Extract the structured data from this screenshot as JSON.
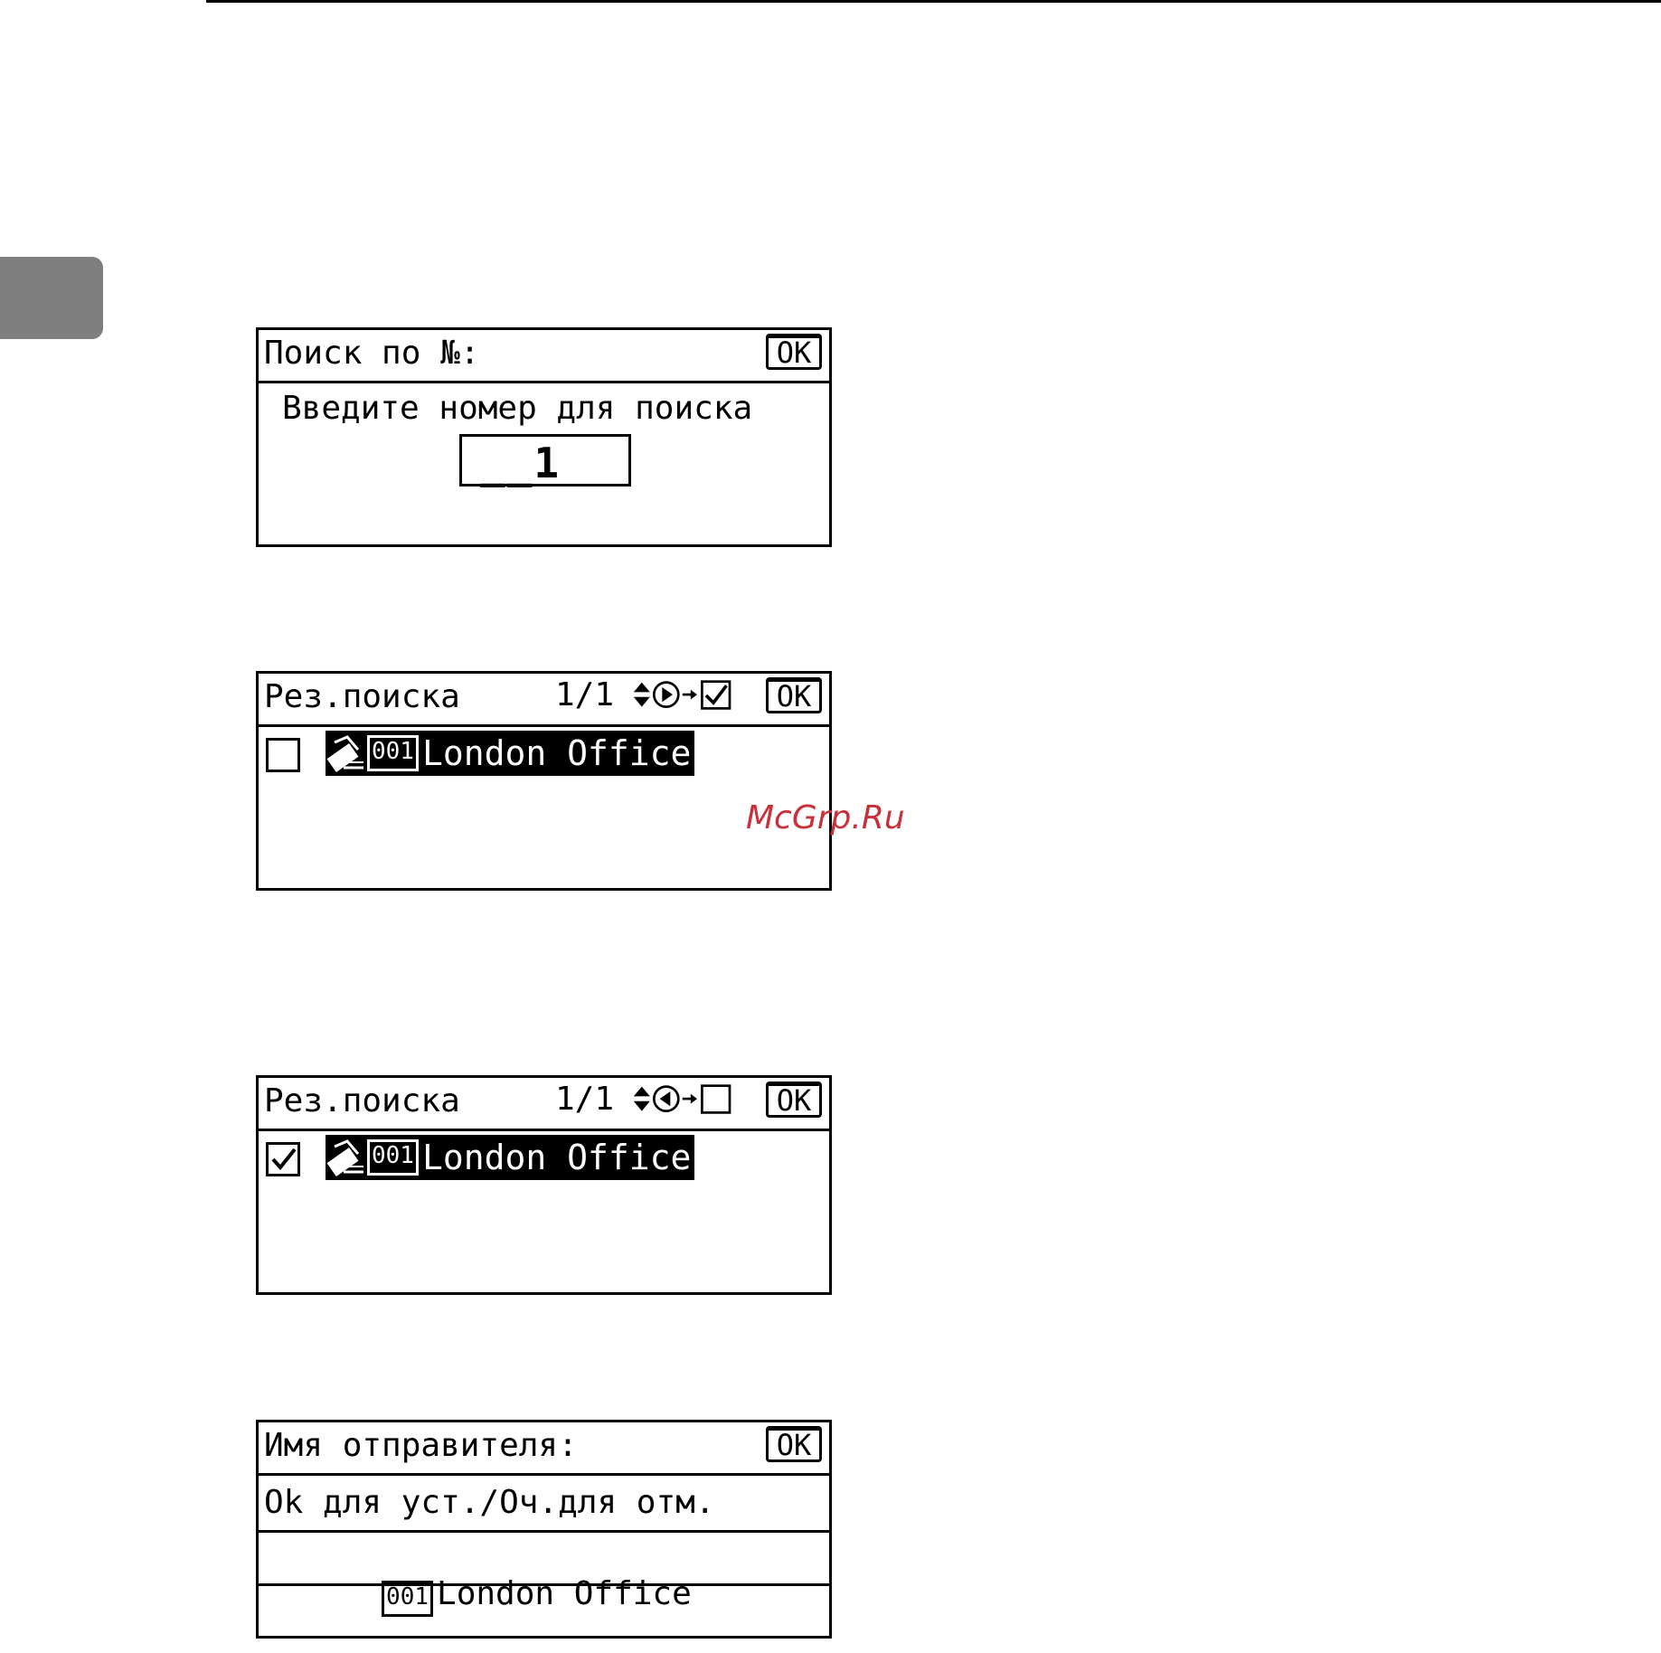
{
  "panel1": {
    "title": "Поиск по №:",
    "ok": "OK",
    "prompt": "Введите номер для поиска",
    "entry_value": "__1"
  },
  "panel2": {
    "title": "Рез.поиска",
    "page": "1/1",
    "ok": "OK",
    "entry_number": "001",
    "entry_name": "London Office",
    "checked": false
  },
  "panel3": {
    "title": "Рез.поиска",
    "page": "1/1",
    "ok": "OK",
    "entry_number": "001",
    "entry_name": "London Office",
    "checked": true
  },
  "panel4": {
    "title": "Имя отправителя:",
    "ok": "OK",
    "hint": "Ok для уст./Оч.для отм.",
    "entry_number": "001",
    "entry_name": "London Office"
  },
  "watermark": "McGrp.Ru"
}
